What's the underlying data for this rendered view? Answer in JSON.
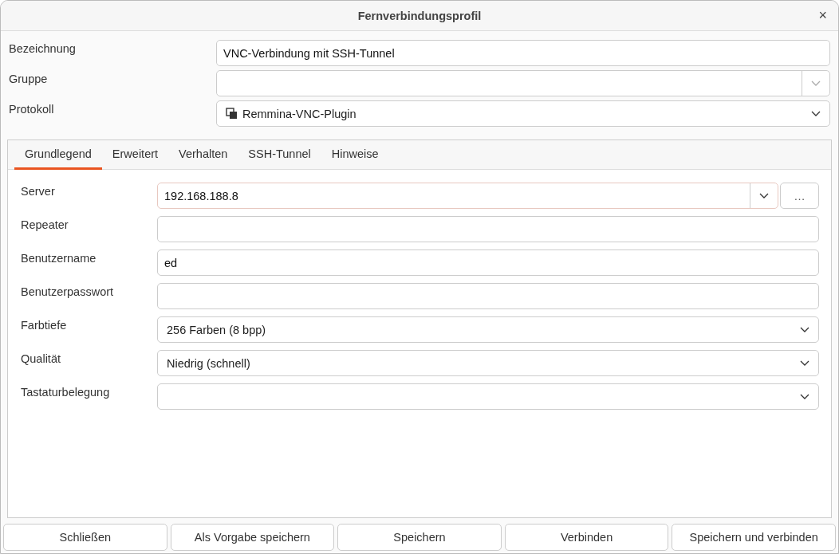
{
  "window": {
    "title": "Fernverbindungsprofil",
    "close": "×"
  },
  "profile_fields": [
    {
      "label": "Bezeichnung",
      "kind": "entry",
      "value": "VNC-Verbindung mit SSH-Tunnel"
    },
    {
      "label": "Gruppe",
      "kind": "combo-entry"
    },
    {
      "label": "Protokoll",
      "kind": "plugin-combo",
      "value": "Remmina-VNC-Plugin"
    }
  ],
  "tabs": [
    {
      "label": "Grundlegend",
      "selected": true
    },
    {
      "label": "Erweitert",
      "selected": false
    },
    {
      "label": "Verhalten",
      "selected": false
    },
    {
      "label": "SSH-Tunnel",
      "selected": false
    },
    {
      "label": "Hinweise",
      "selected": false
    }
  ],
  "fields": [
    {
      "label": "Server",
      "kind": "server",
      "value": "192.168.188.8",
      "browse": "…"
    },
    {
      "label": "Repeater",
      "kind": "entry"
    },
    {
      "label": "Benutzername",
      "kind": "entry",
      "value": "ed"
    },
    {
      "label": "Benutzerpasswort",
      "kind": "entry"
    },
    {
      "label": "Farbtiefe",
      "kind": "combo",
      "value": "256 Farben (8 bpp)"
    },
    {
      "label": "Qualität",
      "kind": "combo",
      "value": "Niedrig (schnell)"
    },
    {
      "label": "Tastaturbelegung",
      "kind": "combo"
    }
  ],
  "buttons": [
    "Schließen",
    "Als Vorgabe speichern",
    "Speichern",
    "Verbinden",
    "Speichern und verbinden"
  ]
}
